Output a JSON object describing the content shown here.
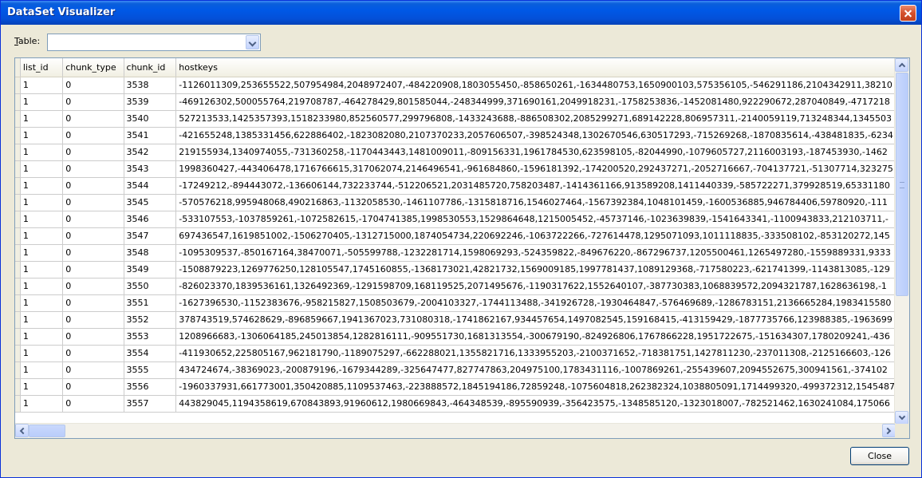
{
  "window": {
    "title": "DataSet Visualizer"
  },
  "toolbar": {
    "table_label_prefix": "T",
    "table_label_rest": "able:",
    "table_value": ""
  },
  "grid": {
    "columns": [
      "list_id",
      "chunk_type",
      "chunk_id",
      "hostkeys"
    ],
    "rows": [
      [
        "1",
        "0",
        "3538",
        "-1126011309,253655522,507954984,2048972407,-484220908,1803055450,-858650261,-1634480753,1650900103,575356105,-546291186,2104342911,38210"
      ],
      [
        "1",
        "0",
        "3539",
        "-469126302,500055764,219708787,-464278429,801585044,-248344999,371690161,2049918231,-1758253836,-1452081480,922290672,287040849,-4717218"
      ],
      [
        "1",
        "0",
        "3540",
        "527213533,1425357393,1518233980,852560577,299796808,-1433243688,-886508302,2085299271,689142228,806957311,-2140059119,713248344,1345503"
      ],
      [
        "1",
        "0",
        "3541",
        "-421655248,1385331456,622886402,-1823082080,2107370233,2057606507,-398524348,1302670546,630517293,-715269268,-1870835614,-438481835,-6234"
      ],
      [
        "1",
        "0",
        "3542",
        "219155934,1340974055,-731360258,-1170443443,1481009011,-809156331,1961784530,623598105,-82044990,-1079605727,2116003193,-187453930,-1462"
      ],
      [
        "1",
        "0",
        "3543",
        "1998360427,-443406478,1716766615,317062074,2146496541,-961684860,-1596181392,-174200520,292437271,-2052716667,-704137721,-51307714,323275"
      ],
      [
        "1",
        "0",
        "3544",
        "-17249212,-894443072,-136606144,732233744,-512206521,2031485720,758203487,-1414361166,913589208,1411440339,-585722271,379928519,65331180"
      ],
      [
        "1",
        "0",
        "3545",
        "-570576218,995948068,490216863,-1132058530,-1461107786,-1315818716,1546027464,-1567392384,1048101459,-1600536885,946784406,59780920,-111"
      ],
      [
        "1",
        "0",
        "3546",
        "-533107553,-1037859261,-1072582615,-1704741385,1998530553,1529864648,1215005452,-45737146,-1023639839,-1541643341,-1100943833,212103711,-"
      ],
      [
        "1",
        "0",
        "3547",
        "697436547,1619851002,-1506270405,-1312715000,1874054734,220692246,-1063722266,-727614478,1295071093,1011118835,-333508102,-853120272,145"
      ],
      [
        "1",
        "0",
        "3548",
        "-1095309537,-850167164,38470071,-505599788,-1232281714,1598069293,-524359822,-849676220,-867296737,1205500461,1265497280,-1559889331,9333"
      ],
      [
        "1",
        "0",
        "3549",
        "-1508879223,1269776250,128105547,1745160855,-1368173021,42821732,1569009185,1997781437,1089129368,-717580223,-621741399,-1143813085,-129"
      ],
      [
        "1",
        "0",
        "3550",
        "-826023370,1839536161,1326492369,-1291598709,168119525,2071495676,-1190317622,1552640107,-387730383,1068839572,2094321787,1628636198,-1"
      ],
      [
        "1",
        "0",
        "3551",
        "-1627396530,-1152383676,-958215827,1508503679,-2004103327,-1744113488,-341926728,-1930464847,-576469689,-1286783151,2136665284,1983415580"
      ],
      [
        "1",
        "0",
        "3552",
        "378743519,574628629,-896859667,1941367023,731080318,-1741862167,934457654,1497082545,159168415,-413159429,-1877735766,123988385,-1963699"
      ],
      [
        "1",
        "0",
        "3553",
        "1208966683,-1306064185,245013854,1282816111,-909551730,1681313554,-300679190,-824926806,1767866228,1951722675,-151634307,1780209241,-436"
      ],
      [
        "1",
        "0",
        "3554",
        "-411930652,225805167,962181790,-1189075297,-662288021,1355821716,1333955203,-2100371652,-718381751,1427811230,-237011308,-2125166603,-126"
      ],
      [
        "1",
        "0",
        "3555",
        "434724674,-38369023,-200879196,-1679344289,-325647477,827747863,204975100,1783431116,-1007869261,-255439607,2094552675,300941561,-374102"
      ],
      [
        "1",
        "0",
        "3556",
        "-1960337931,661773001,350420885,1109537463,-223888572,1845194186,72859248,-1075604818,262382324,1038805091,1714499320,-499372312,1545487"
      ],
      [
        "1",
        "0",
        "3557",
        "443829045,1194358619,670843893,91960612,1980669843,-464348539,-895590939,-356423575,-1348585120,-1323018007,-782521462,1630241084,175066"
      ]
    ]
  },
  "footer": {
    "close_label": "Close"
  }
}
